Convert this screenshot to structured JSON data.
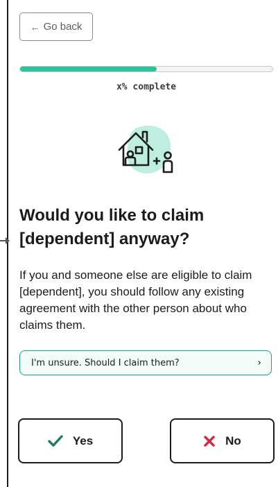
{
  "nav": {
    "back_label": "Go back",
    "back_icon": "left-arrow-icon"
  },
  "progress": {
    "fraction": 0.54,
    "text": "x% complete",
    "fill_color": "#2ac39c"
  },
  "illustration": {
    "icon": "house-with-dependent-icon",
    "accent_color": "#bdeee0"
  },
  "question": {
    "heading": "Would you like to claim [dependent] anyway?",
    "body": "If you and someone else are eligible to claim [dependent], you should follow any existing agreement with the other person about who claims them."
  },
  "help_link": {
    "label": "I'm unsure. Should I claim them?",
    "icon": "chevron-right-icon"
  },
  "answers": {
    "yes_label": "Yes",
    "yes_icon": "checkmark-icon",
    "yes_color": "#1f7a5c",
    "no_label": "No",
    "no_icon": "x-icon",
    "no_color": "#d7263d"
  }
}
